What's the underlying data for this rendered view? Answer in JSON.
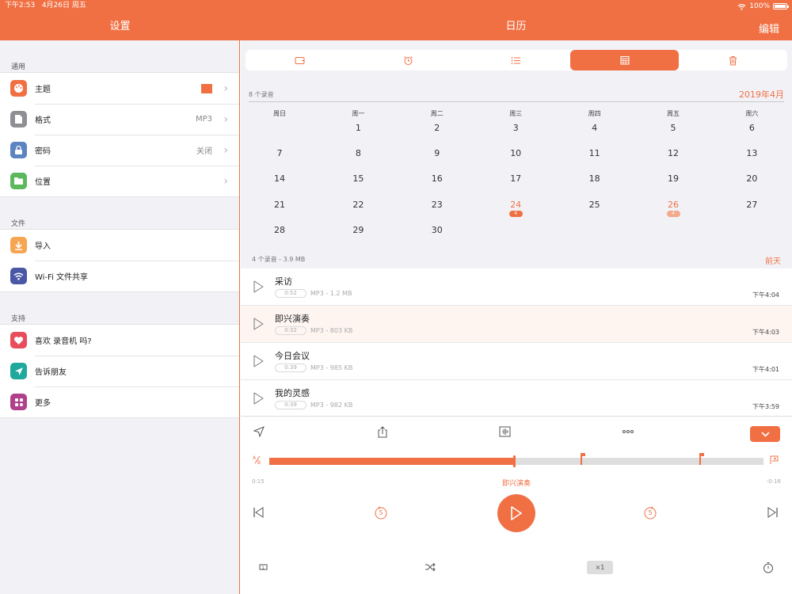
{
  "status": {
    "time": "下午2:53",
    "date": "4月26日 周五",
    "battery": "100%"
  },
  "nav": {
    "left_title": "设置",
    "center_title": "日历",
    "edit": "编辑"
  },
  "sidebar": {
    "general_header": "通用",
    "general": [
      {
        "label": "主题",
        "value": "",
        "icon": "palette-icon",
        "color": "#f07044"
      },
      {
        "label": "格式",
        "value": "MP3",
        "icon": "file-icon",
        "color": "#8e8e93"
      },
      {
        "label": "密码",
        "value": "关闭",
        "icon": "lock-icon",
        "color": "#5b84c0"
      },
      {
        "label": "位置",
        "value": "",
        "icon": "folder-icon",
        "color": "#5cb85c"
      }
    ],
    "files_header": "文件",
    "files": [
      {
        "label": "导入",
        "icon": "import-icon",
        "color": "#f6a552"
      },
      {
        "label": "Wi-Fi 文件共享",
        "icon": "wifi-icon",
        "color": "#4a56a6"
      }
    ],
    "support_header": "支持",
    "support": [
      {
        "label": "喜欢 录音机 吗?",
        "icon": "heart-icon",
        "color": "#e84d5b"
      },
      {
        "label": "告诉朋友",
        "icon": "send-icon",
        "color": "#1fa89c"
      },
      {
        "label": "更多",
        "icon": "apps-icon",
        "color": "#b0408a"
      }
    ],
    "theme_color": "#f07044"
  },
  "tabs": [
    "wallet-icon",
    "alarm-icon",
    "list-icon",
    "calendar-icon",
    "trash-icon"
  ],
  "calendar": {
    "record_count": "8 个录音",
    "month": "2019年4月",
    "weekdays": [
      "周日",
      "周一",
      "周二",
      "周三",
      "周四",
      "周五",
      "周六"
    ],
    "weeks": [
      [
        "",
        "1",
        "2",
        "3",
        "4",
        "5",
        "6"
      ],
      [
        "7",
        "8",
        "9",
        "10",
        "11",
        "12",
        "13"
      ],
      [
        "14",
        "15",
        "16",
        "17",
        "18",
        "19",
        "20"
      ],
      [
        "21",
        "22",
        "23",
        "24",
        "25",
        "26",
        "27"
      ],
      [
        "28",
        "29",
        "30",
        "",
        "",
        "",
        ""
      ]
    ],
    "highlighted": [
      {
        "day": "24",
        "count": "4",
        "selected": true
      },
      {
        "day": "26",
        "count": "4",
        "selected": false
      }
    ]
  },
  "list": {
    "summary": "4 个录音 - 3.9 MB",
    "day_label": "前天",
    "recordings": [
      {
        "title": "采访",
        "duration": "0:52",
        "meta": "MP3 - 1.2 MB",
        "time": "下午4:04",
        "selected": false
      },
      {
        "title": "即兴演奏",
        "duration": "0:32",
        "meta": "MP3 - 803 KB",
        "time": "下午4:03",
        "selected": true
      },
      {
        "title": "今日会议",
        "duration": "0:39",
        "meta": "MP3 - 985 KB",
        "time": "下午4:01",
        "selected": false
      },
      {
        "title": "我的灵感",
        "duration": "0:39",
        "meta": "MP3 - 982 KB",
        "time": "下午3:59",
        "selected": false
      }
    ]
  },
  "player": {
    "elapsed": "0:15",
    "remaining": "-0:16",
    "title": "即兴演奏",
    "progress": 0.495,
    "markers": [
      0.63,
      0.87
    ],
    "skip_back": "5",
    "skip_forward": "5",
    "speed": "×1"
  }
}
